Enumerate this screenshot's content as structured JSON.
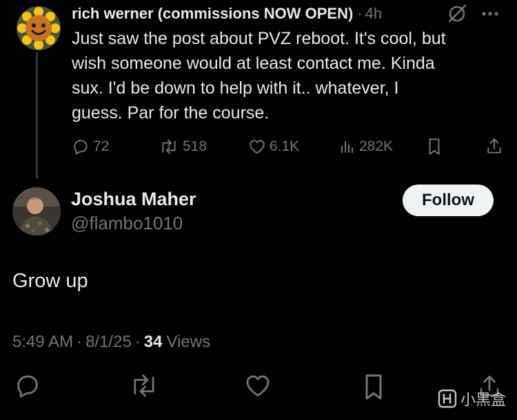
{
  "parent_tweet": {
    "author_name": "rich werner (commissions NOW OPEN)",
    "separator": "·",
    "time_ago": "4h",
    "text": "Just saw the post about PVZ reboot. It's cool, but\nwish someone would at least contact me.  Kinda\nsux. I'd be down to help with it.. whatever, I\nguess. Par for the course.",
    "stats": {
      "replies": "72",
      "reposts": "518",
      "likes": "6.1K",
      "views": "282K"
    },
    "icons": {
      "grok": "grok-slash-icon",
      "more": "more-icon",
      "reply": "reply-icon",
      "repost": "repost-icon",
      "like": "heart-icon",
      "views": "analytics-icon",
      "bookmark": "bookmark-icon",
      "share": "share-icon"
    }
  },
  "reply": {
    "author_name": "Joshua Maher",
    "handle": "@flambo1010",
    "follow_label": "Follow",
    "text": "Grow up",
    "time": "5:49 AM",
    "separator": "·",
    "date": "8/1/25",
    "views_count": "34",
    "views_label": "Views"
  },
  "watermark": {
    "text": "小黑盒",
    "logo": "heybox-logo-icon"
  },
  "colors": {
    "background": "#000000",
    "primary_text": "#e7e9ea",
    "secondary_text": "#71767b",
    "follow_button_bg": "#eff3f4",
    "follow_button_text": "#0f1419"
  }
}
